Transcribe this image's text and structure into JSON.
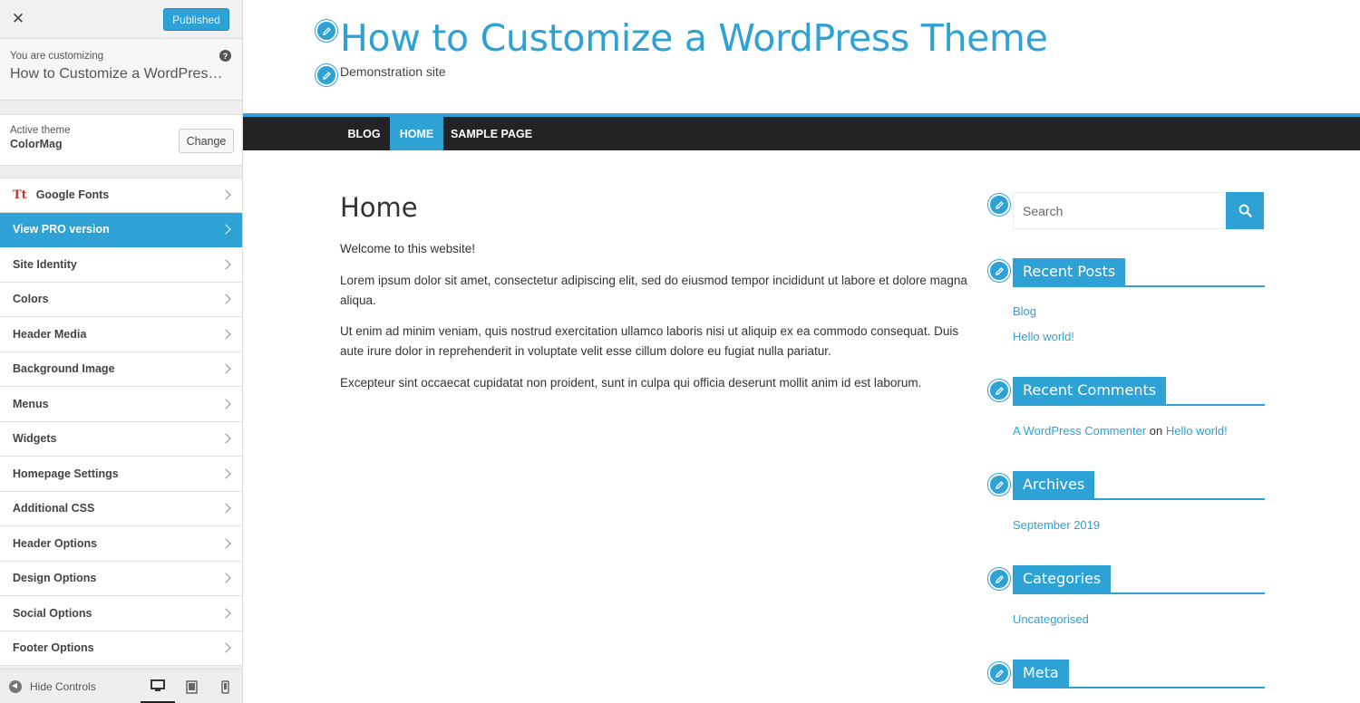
{
  "panel": {
    "close": "✕",
    "publish_label": "Published",
    "customizing_label": "You are customizing",
    "customizing_site": "How to Customize a WordPress Theme",
    "help": "?",
    "active_theme_label": "Active theme",
    "active_theme_name": "ColorMag",
    "change_label": "Change",
    "google_fonts_icon": "Tt",
    "menu": [
      "Google Fonts",
      "View PRO version",
      "Site Identity",
      "Colors",
      "Header Media",
      "Background Image",
      "Menus",
      "Widgets",
      "Homepage Settings",
      "Additional CSS",
      "Header Options",
      "Design Options",
      "Social Options",
      "Footer Options"
    ],
    "hide_controls": "Hide Controls"
  },
  "site": {
    "title": "How to Customize a WordPress Theme",
    "description": "Demonstration site",
    "nav": [
      "BLOG",
      "HOME",
      "SAMPLE PAGE"
    ],
    "page_title": "Home",
    "paragraphs": [
      "Welcome to this website!",
      "Lorem ipsum dolor sit amet, consectetur adipiscing elit, sed do eiusmod tempor incididunt ut labore et dolore magna aliqua.",
      "Ut enim ad minim veniam, quis nostrud exercitation ullamco laboris nisi ut aliquip ex ea commodo consequat. Duis aute irure dolor in reprehenderit in voluptate velit esse cillum dolore eu fugiat nulla pariatur.",
      "Excepteur sint occaecat cupidatat non proident, sunt in culpa qui officia deserunt mollit anim id est laborum."
    ]
  },
  "sidebar": {
    "search_placeholder": "Search",
    "recent_posts": {
      "title": "Recent Posts",
      "items": [
        "Blog",
        "Hello world!"
      ]
    },
    "recent_comments": {
      "title": "Recent Comments",
      "author": "A WordPress Commenter",
      "on": "on",
      "post": "Hello world!"
    },
    "archives": {
      "title": "Archives",
      "items": [
        "September 2019"
      ]
    },
    "categories": {
      "title": "Categories",
      "items": [
        "Uncategorised"
      ]
    },
    "meta": {
      "title": "Meta"
    }
  },
  "colors": {
    "accent": "#2ea1d5",
    "nav_bg": "#232323",
    "panel_bg": "#eeeeee"
  },
  "icons": {
    "close": "close-icon",
    "help": "help-icon",
    "chevron": "chevron-right-icon",
    "pencil": "pencil-edit-icon",
    "search": "search-icon",
    "desktop": "desktop-icon",
    "tablet": "tablet-icon",
    "mobile": "mobile-icon"
  }
}
